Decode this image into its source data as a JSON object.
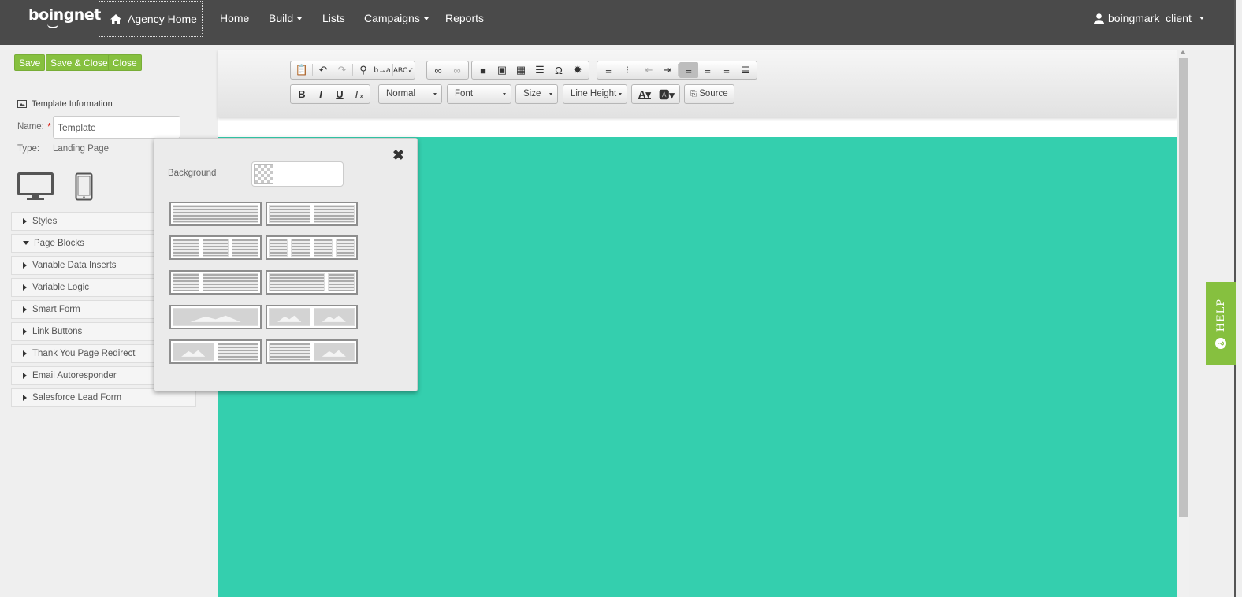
{
  "app": {
    "logo_text": "boingnet",
    "nav": {
      "agency_home": "Agency Home",
      "home": "Home",
      "build": "Build",
      "lists": "Lists",
      "campaigns": "Campaigns",
      "reports": "Reports"
    },
    "user": "boingmark_client"
  },
  "left": {
    "buttons": {
      "save": "Save",
      "save_close": "Save & Close",
      "close": "Close"
    },
    "template_info": "Template Information",
    "name_label": "Name:",
    "required_mark": "*",
    "name_value": "Template",
    "type_label": "Type:",
    "type_value": "Landing Page",
    "sections": [
      "Styles",
      "Page Blocks",
      "Variable Data Inserts",
      "Variable Logic",
      "Smart Form",
      "Link Buttons",
      "Thank You Page Redirect",
      "Email Autoresponder",
      "Salesforce Lead Form"
    ],
    "expanded_section": "Page Blocks"
  },
  "toolbar": {
    "format": "Normal",
    "font": "Font",
    "size": "Size",
    "line_height": "Line Height",
    "source": "Source"
  },
  "popup": {
    "background_label": "Background",
    "close_glyph": "✖"
  },
  "help": {
    "label": "HELP",
    "glyph": "?"
  },
  "colors": {
    "topbar": "#4a4a4a",
    "accent_green": "#86c03f",
    "canvas_teal": "#34cfae"
  }
}
